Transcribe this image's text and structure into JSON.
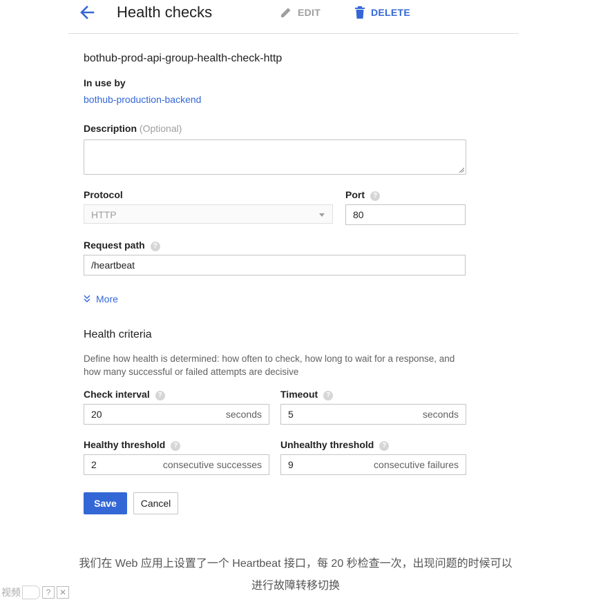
{
  "header": {
    "title": "Health checks",
    "edit_label": "EDIT",
    "delete_label": "DELETE"
  },
  "resource_name": "bothub-prod-api-group-health-check-http",
  "in_use_by": {
    "label": "In use by",
    "value": "bothub-production-backend"
  },
  "description": {
    "label": "Description",
    "optional": "(Optional)",
    "value": ""
  },
  "protocol": {
    "label": "Protocol",
    "value": "HTTP"
  },
  "port": {
    "label": "Port",
    "value": "80"
  },
  "request_path": {
    "label": "Request path",
    "value": "/heartbeat"
  },
  "more_label": "More",
  "health_criteria": {
    "title": "Health criteria",
    "description": "Define how health is determined: how often to check, how long to wait for a response, and how many successful or failed attempts are decisive",
    "check_interval": {
      "label": "Check interval",
      "value": "20",
      "suffix": "seconds"
    },
    "timeout": {
      "label": "Timeout",
      "value": "5",
      "suffix": "seconds"
    },
    "healthy_threshold": {
      "label": "Healthy threshold",
      "value": "2",
      "suffix": "consecutive successes"
    },
    "unhealthy_threshold": {
      "label": "Unhealthy threshold",
      "value": "9",
      "suffix": "consecutive failures"
    }
  },
  "actions": {
    "save": "Save",
    "cancel": "Cancel"
  },
  "caption": {
    "line1": "我们在 Web 应用上设置了一个 Heartbeat 接口，每 20 秒检查一次，出现问题的时候可以",
    "line2": "进行故障转移切换"
  },
  "footer": {
    "label": "视频",
    "help": "?",
    "close": "✕"
  },
  "colors": {
    "accent": "#3367d6",
    "text": "#212121",
    "muted": "#9e9e9e",
    "border": "#c4c4c4"
  },
  "icons": [
    "back-arrow-icon",
    "pencil-icon",
    "trash-icon",
    "help-icon",
    "chevron-double-down-icon"
  ]
}
